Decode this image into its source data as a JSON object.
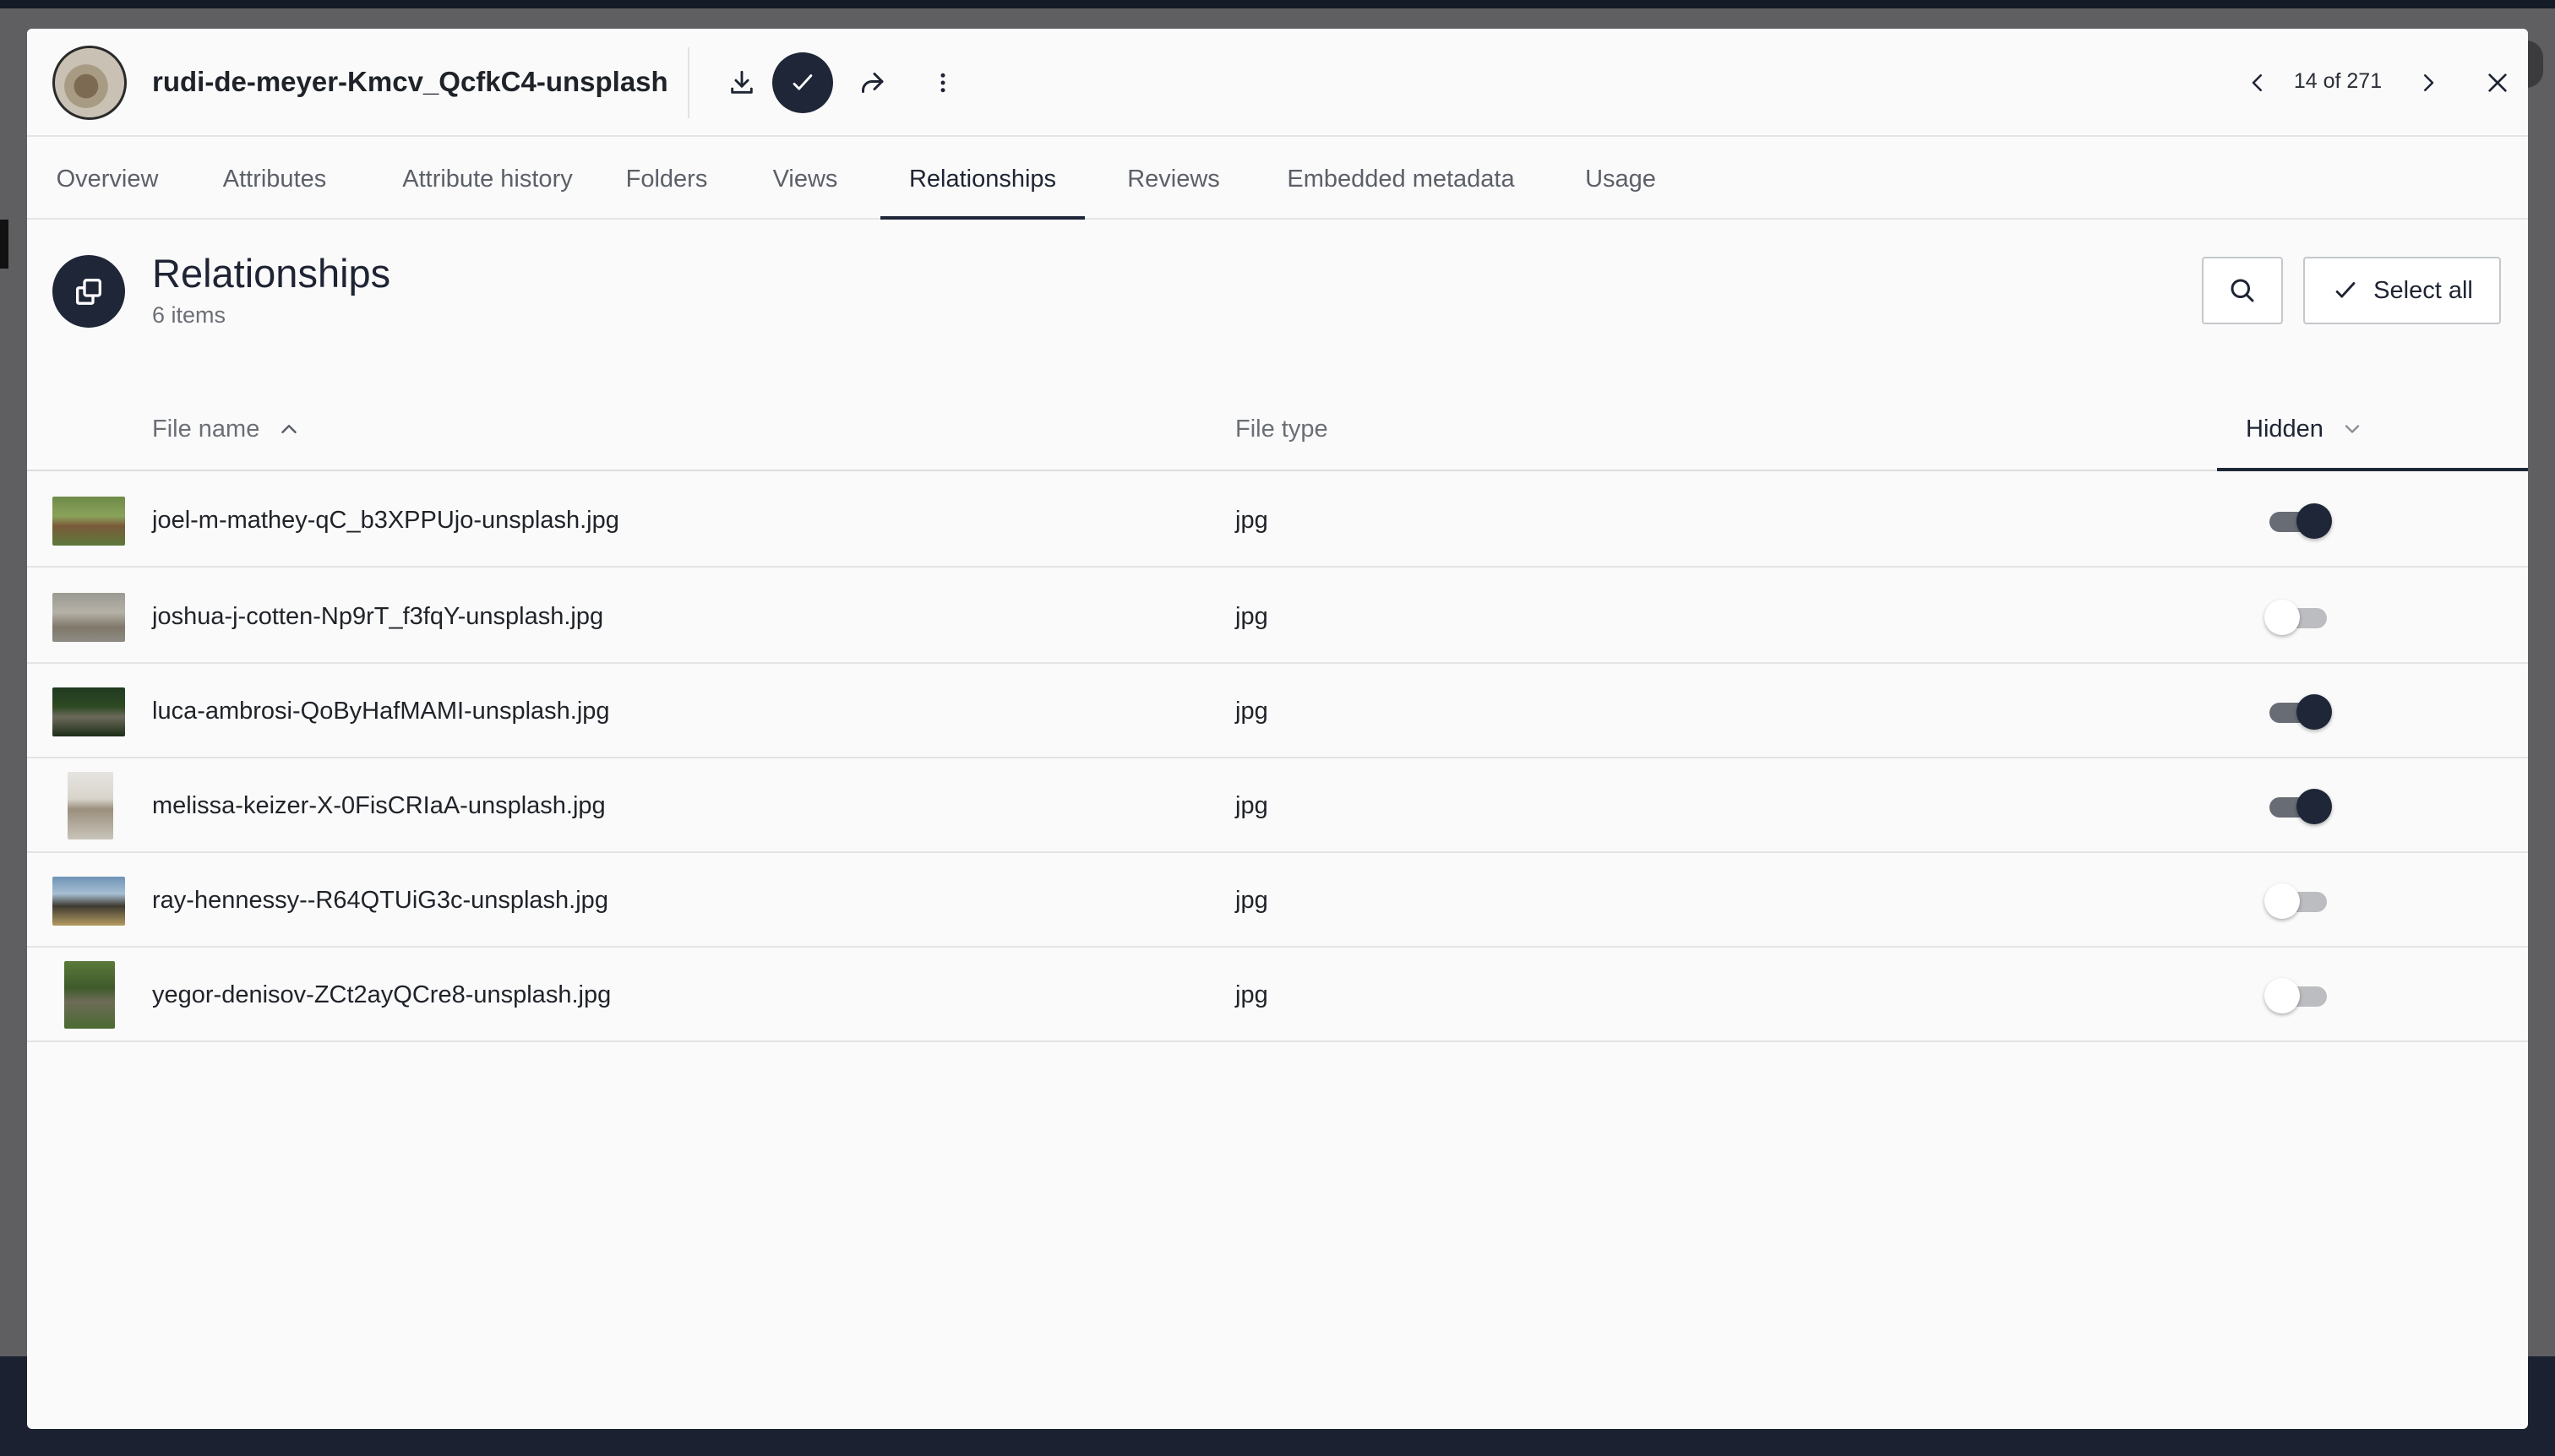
{
  "header": {
    "asset_title": "rudi-de-meyer-Kmcv_QcfkC4-unsplash",
    "pager": "14 of 271"
  },
  "tabs": [
    {
      "label": "Overview"
    },
    {
      "label": "Attributes"
    },
    {
      "label": "Attribute history"
    },
    {
      "label": "Folders"
    },
    {
      "label": "Views"
    },
    {
      "label": "Relationships",
      "active": true
    },
    {
      "label": "Reviews"
    },
    {
      "label": "Embedded metadata"
    },
    {
      "label": "Usage"
    }
  ],
  "section": {
    "title": "Relationships",
    "count": "6 items",
    "select_all_label": "Select all"
  },
  "table": {
    "columns": {
      "file_name": "File name",
      "file_type": "File type",
      "hidden": "Hidden"
    },
    "rows": [
      {
        "name": "joel-m-mathey-qC_b3XPPUjo-unsplash.jpg",
        "type": "jpg",
        "hidden": true
      },
      {
        "name": "joshua-j-cotten-Np9rT_f3fqY-unsplash.jpg",
        "type": "jpg",
        "hidden": false
      },
      {
        "name": "luca-ambrosi-QoByHafMAMI-unsplash.jpg",
        "type": "jpg",
        "hidden": true
      },
      {
        "name": "melissa-keizer-X-0FisCRIaA-unsplash.jpg",
        "type": "jpg",
        "hidden": true
      },
      {
        "name": "ray-hennessy--R64QTUiG3c-unsplash.jpg",
        "type": "jpg",
        "hidden": false
      },
      {
        "name": "yegor-denisov-ZCt2ayQCre8-unsplash.jpg",
        "type": "jpg",
        "hidden": false
      }
    ]
  },
  "icons": {
    "download": "download-icon",
    "check": "check-icon",
    "share": "share-icon",
    "more": "more-vertical-icon",
    "prev": "chevron-left-icon",
    "next": "chevron-right-icon",
    "close": "close-icon",
    "relationships": "copy-icon",
    "search": "search-icon"
  },
  "colors": {
    "accent": "#1e2638",
    "toggle_on_track": "#686c74",
    "toggle_off_track": "#bcbdc0"
  }
}
